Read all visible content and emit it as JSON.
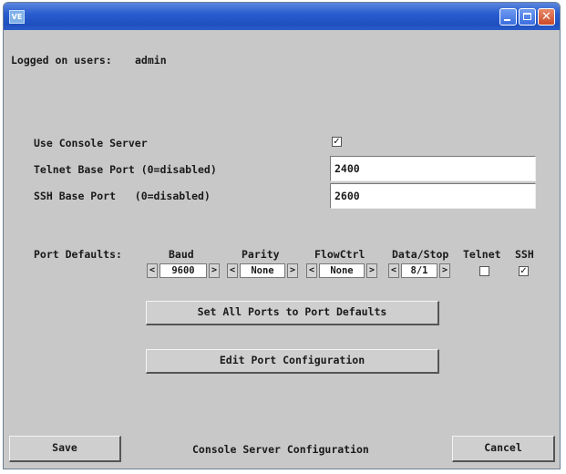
{
  "window": {
    "app_icon_text": "VE",
    "title_text": ""
  },
  "status": {
    "logged_on_label": "Logged on users:",
    "logged_on_value": "admin"
  },
  "console": {
    "use_console_label": "Use Console Server",
    "use_console_checked": true,
    "telnet_label": "Telnet Base Port (0=disabled)",
    "telnet_value": "2400",
    "ssh_label": "SSH Base Port   (0=disabled)",
    "ssh_value": "2600"
  },
  "port_defaults": {
    "label": "Port Defaults:",
    "headers": {
      "baud": "Baud",
      "parity": "Parity",
      "flowctrl": "FlowCtrl",
      "datastop": "Data/Stop",
      "telnet": "Telnet",
      "ssh": "SSH"
    },
    "values": {
      "baud": "9600",
      "parity": "None",
      "flowctrl": "None",
      "datastop": "8/1"
    },
    "telnet_checked": false,
    "ssh_checked": true,
    "arrow_left": "<",
    "arrow_right": ">",
    "check_glyph": "✓"
  },
  "buttons": {
    "set_all": "Set All Ports to Port Defaults",
    "edit_port": "Edit Port Configuration",
    "save": "Save",
    "cancel": "Cancel"
  },
  "footer": {
    "page_title": "Console Server Configuration"
  }
}
